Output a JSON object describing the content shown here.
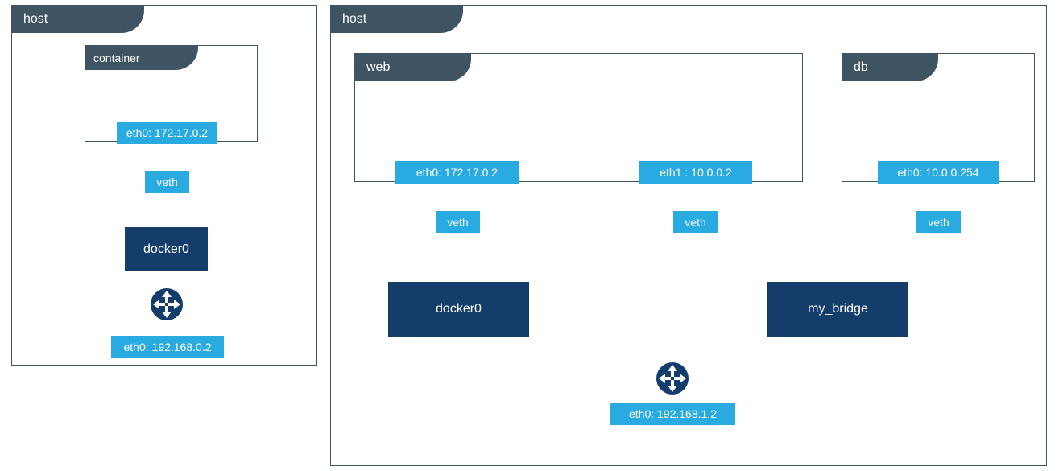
{
  "colors": {
    "frame_border": "#3f5463",
    "tab_bg": "#3f5463",
    "chip_bg": "#29abe2",
    "bridge_bg": "#143d6b",
    "wire": "#b7c3cf"
  },
  "left": {
    "host_label": "host",
    "container_label": "container",
    "container_eth": "eth0: 172.17.0.2",
    "veth": "veth",
    "bridge": "docker0",
    "host_eth": "eth0: 192.168.0.2"
  },
  "right": {
    "host_label": "host",
    "web": {
      "label": "web",
      "eth0": "eth0: 172.17.0.2",
      "eth1": "eth1 : 10.0.0.2"
    },
    "db": {
      "label": "db",
      "eth0": "eth0: 10.0.0.254"
    },
    "veth": "veth",
    "bridge_left": "docker0",
    "bridge_right": "my_bridge",
    "host_eth": "eth0: 192.168.1.2"
  }
}
